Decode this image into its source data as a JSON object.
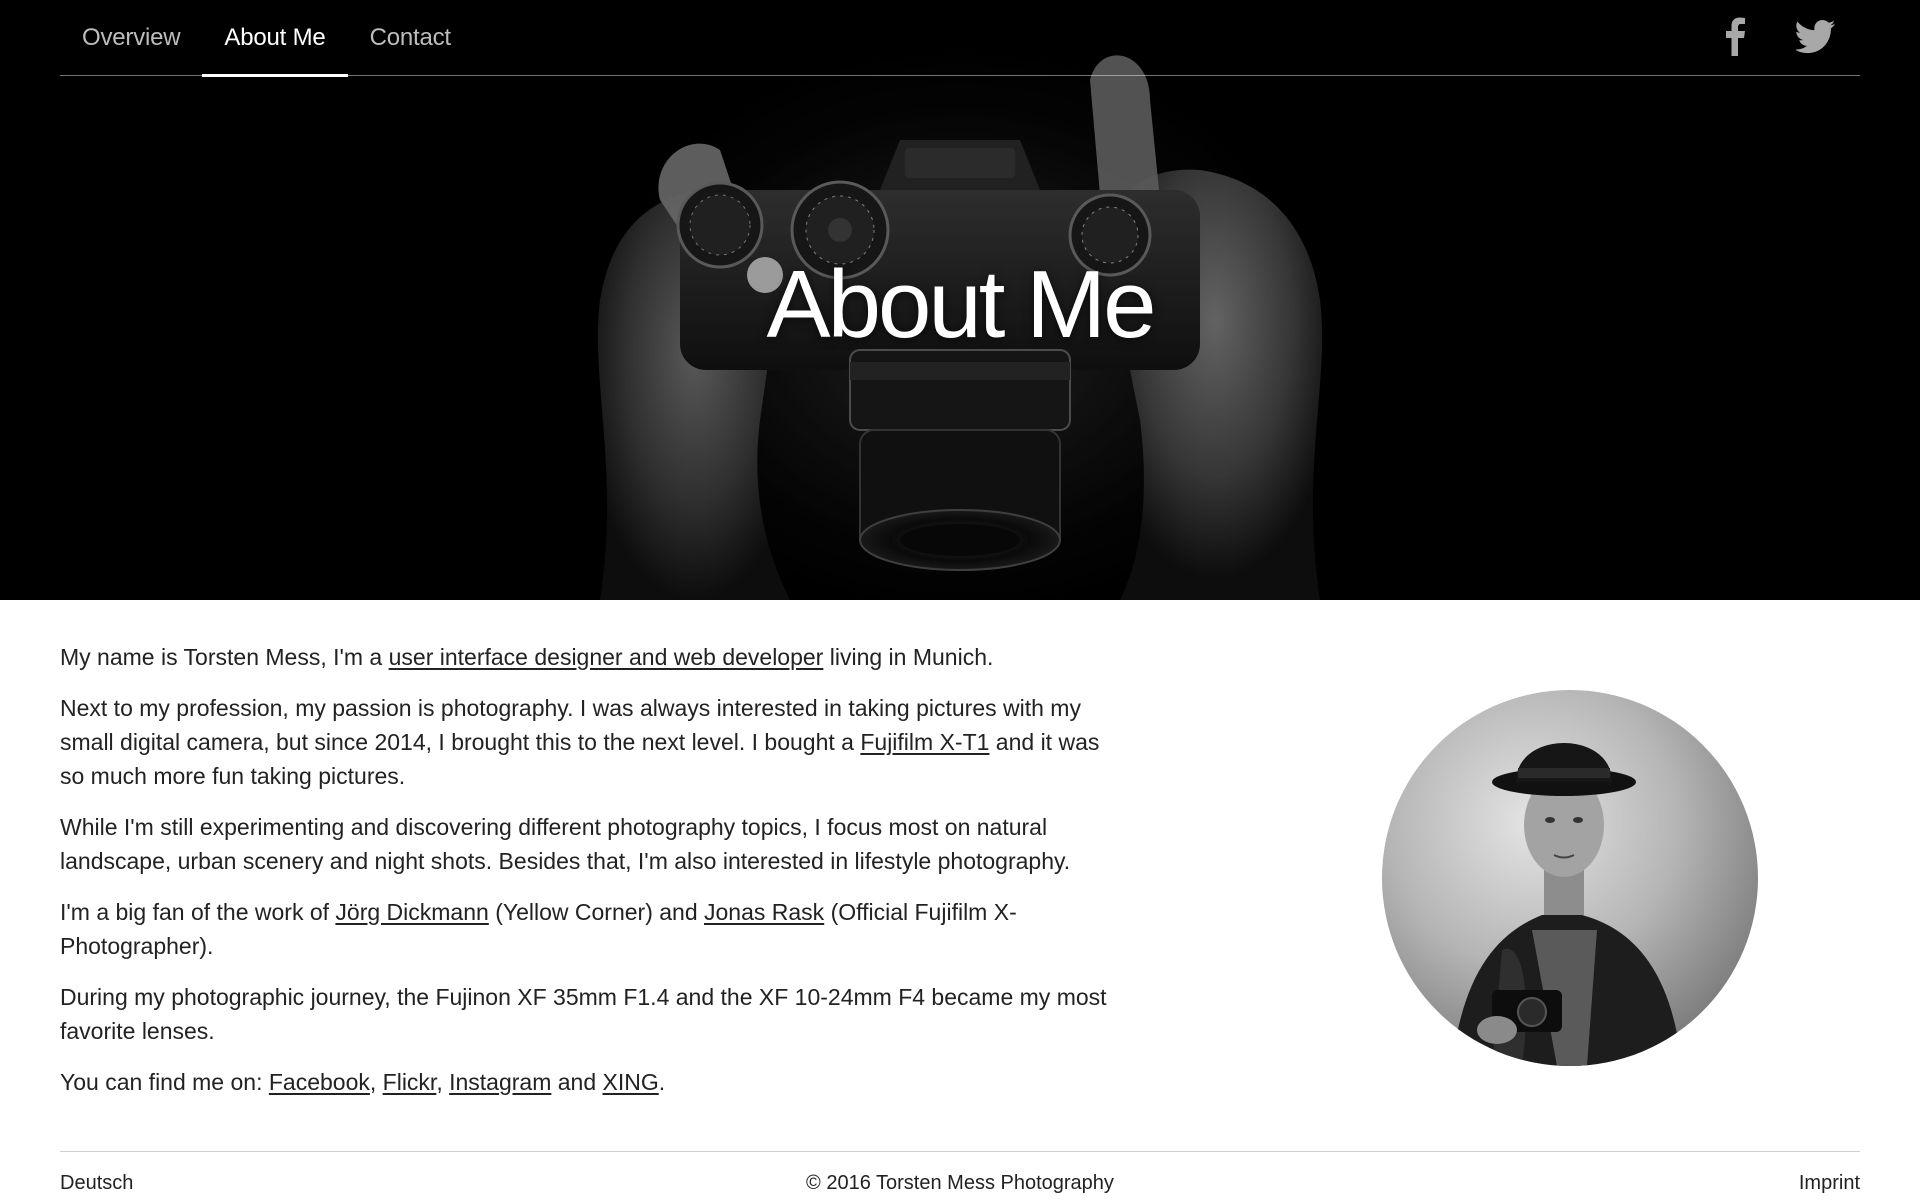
{
  "nav": {
    "tabs": [
      {
        "label": "Overview"
      },
      {
        "label": "About Me"
      },
      {
        "label": "Contact"
      }
    ],
    "social": [
      "facebook-icon",
      "twitter-icon"
    ]
  },
  "hero": {
    "title": "About Me",
    "image": "hands holding Fujifilm X-T1 camera, black and white"
  },
  "content": {
    "p1": {
      "pre": "My name is Torsten Mess, I'm a ",
      "link": "user interface designer and web developer",
      "post": " living in Munich."
    },
    "p2": {
      "pre": "Next to my profession, my passion is photography. I was always interested in taking pictures with my small digital camera, but since 2014, I brought this to the next level. I bought a ",
      "link": "Fujifilm X-T1",
      "post": " and it was so much more fun taking pictures."
    },
    "p3": {
      "text": "While I'm still experimenting and discovering different photography topics, I focus most on natural landscape, urban scenery and night shots. Besides that, I'm also interested in lifestyle photography."
    },
    "p4": {
      "pre": "I'm a big fan of the work of ",
      "link1": "Jörg Dickmann",
      "mid": " (Yellow Corner) and ",
      "link2": "Jonas Rask",
      "post": " (Official Fujifilm X-Photographer)."
    },
    "p5": {
      "text": "During my photographic journey, the Fujinon XF 35mm F1.4 and the XF 10-24mm F4 became my most favorite lenses."
    },
    "p6": {
      "pre": "You can find me on: ",
      "link1": "Facebook",
      "sep1": ", ",
      "link2": "Flickr",
      "sep2": ", ",
      "link3": "Instagram",
      "sep3": " and ",
      "link4": "XING",
      "post": "."
    }
  },
  "footer": {
    "language": "Deutsch",
    "copyright": "© 2016 Torsten Mess Photography",
    "imprint": "Imprint"
  },
  "colors": {
    "hero_bg": "#000000",
    "text": "#222222",
    "nav_inactive": "#bdbdbd",
    "nav_active": "#ffffff"
  }
}
